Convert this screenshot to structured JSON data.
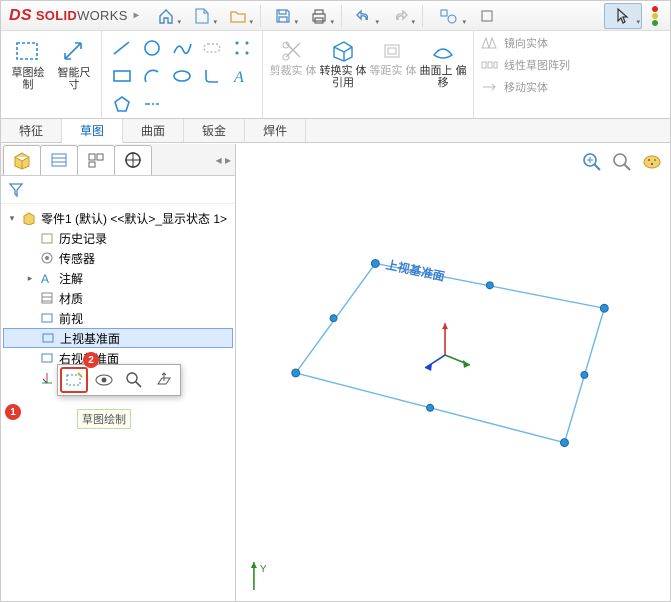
{
  "app": {
    "brand_ds": "DS",
    "brand_solid": "SOLID",
    "brand_works": "WORKS"
  },
  "ribbon": {
    "big1": "草图绘\n制",
    "big2": "智能尺\n寸",
    "cmd_trim": "剪裁实\n体",
    "cmd_convert": "转换实\n体引用",
    "cmd_offset": "等距实\n体",
    "cmd_curve": "曲面上\n偏移",
    "side_mirror": "镜向实体",
    "side_pattern": "线性草图阵列",
    "side_move": "移动实体"
  },
  "tabs": {
    "t1": "特征",
    "t2": "草图",
    "t3": "曲面",
    "t4": "钣金",
    "t5": "焊件"
  },
  "tree": {
    "root": "零件1 (默认) <<默认>_显示状态 1>",
    "history": "历史记录",
    "sensors": "传感器",
    "annotations": "注解",
    "material": "材质",
    "front": "前视",
    "top": "上视基准面",
    "right": "右视基准面",
    "origin": "原点"
  },
  "tooltip": "草图绘制",
  "badges": {
    "b1": "1",
    "b2": "2"
  },
  "canvas": {
    "plane_label": "上视基准面",
    "axis_y": "Y"
  }
}
